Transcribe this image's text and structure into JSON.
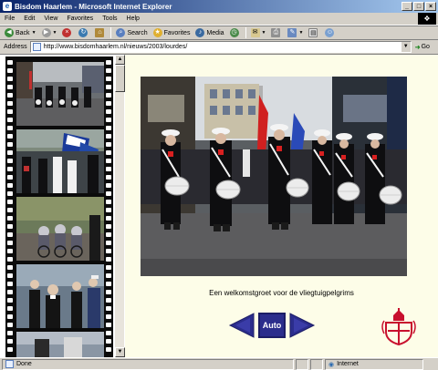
{
  "window": {
    "title": "Bisdom Haarlem - Microsoft Internet Explorer"
  },
  "menu": {
    "items": [
      "File",
      "Edit",
      "View",
      "Favorites",
      "Tools",
      "Help"
    ]
  },
  "toolbar": {
    "back": "Back",
    "search": "Search",
    "favorites": "Favorites",
    "media": "Media"
  },
  "address": {
    "label": "Address",
    "url": "http://www.bisdomhaarlem.nl/nieuws/2003/lourdes/",
    "go": "Go"
  },
  "slideshow": {
    "caption": "Een welkomstgroet voor de vliegtuigpelgrims",
    "auto_label": "Auto"
  },
  "status": {
    "text": "Done",
    "zone": "Internet"
  },
  "colors": {
    "nav_blue": "#2b2d8c",
    "page_bg": "#fdfde8",
    "crest_red": "#c8102e"
  }
}
